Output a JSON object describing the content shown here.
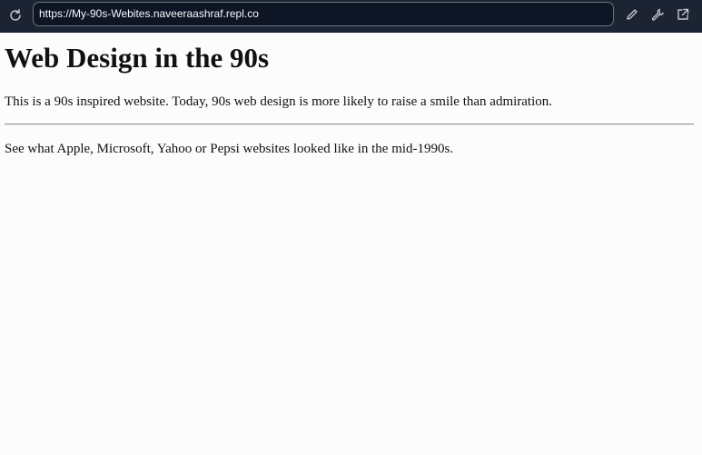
{
  "browser": {
    "url": "https://My-90s-Webites.naveeraashraf.repl.co",
    "icons": {
      "reload": "reload-icon",
      "edit": "pencil-icon",
      "tools": "wrench-icon",
      "open_external": "external-link-icon"
    }
  },
  "page": {
    "heading": "Web Design in the 90s",
    "intro": "This is a 90s inspired website. Today, 90s web design is more likely to raise a smile than admiration.",
    "outro": "See what Apple, Microsoft, Yahoo or Pepsi websites looked like in the mid-1990s."
  },
  "colors": {
    "toolbar_bg": "#1c2333",
    "url_field_bg": "#0e1525",
    "page_bg": "#fcfcfd"
  }
}
